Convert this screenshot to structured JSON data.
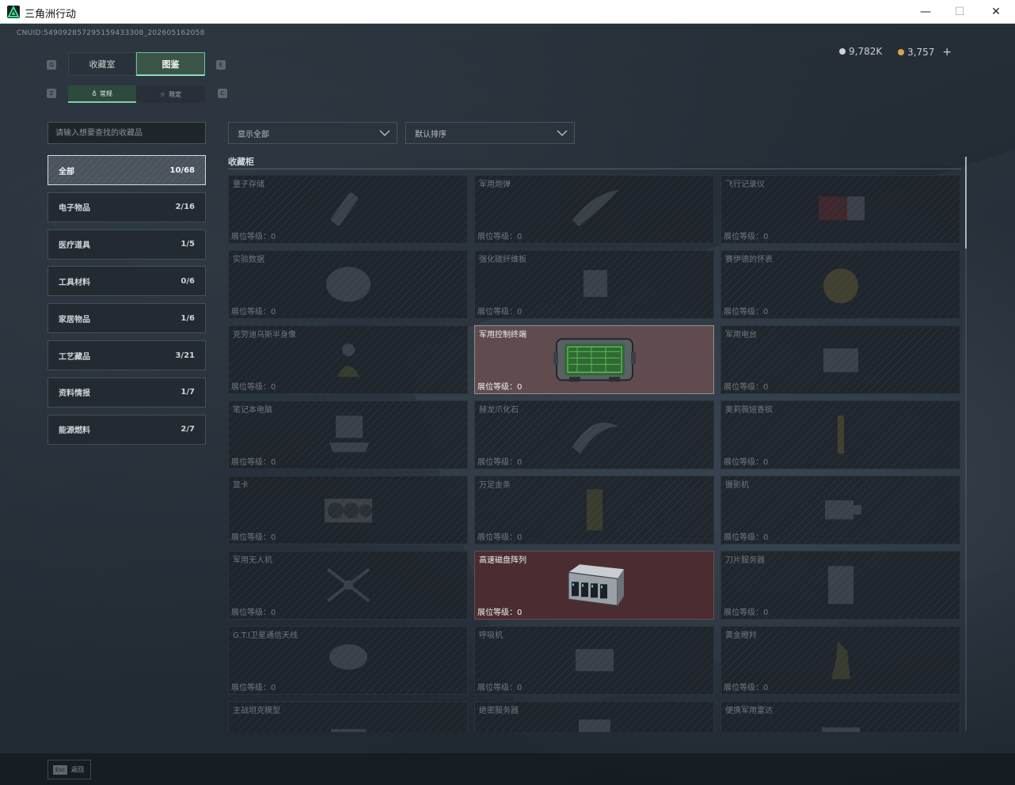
{
  "window": {
    "title": "三角洲行动",
    "minimize": "—",
    "maximize": "☐",
    "close": "✕"
  },
  "uid": "CNUID:549092857295159433308_202605162058",
  "currency": [
    {
      "value": "9,782K",
      "color": "#cfd4d8"
    },
    {
      "value": "3,757",
      "color": "#d7a64a",
      "add": "+"
    }
  ],
  "main_tabs": [
    {
      "label": "收藏室",
      "active": false
    },
    {
      "label": "图鉴",
      "active": true
    }
  ],
  "main_tab_keys": {
    "left": "Q",
    "right": "E"
  },
  "sub_tabs": [
    {
      "label": "常规",
      "icon": "leaf-icon",
      "active": true
    },
    {
      "label": "限定",
      "icon": "star-icon",
      "active": false
    }
  ],
  "sub_tab_keys": {
    "left": "Z",
    "right": "C"
  },
  "search": {
    "placeholder": "请输入想要查找的收藏品",
    "value": ""
  },
  "filters": [
    {
      "label": "显示全部"
    },
    {
      "label": "默认排序"
    }
  ],
  "categories": [
    {
      "label": "全部",
      "count": "10/68",
      "active": true
    },
    {
      "label": "电子物品",
      "count": "2/16"
    },
    {
      "label": "医疗道具",
      "count": "1/5"
    },
    {
      "label": "工具材料",
      "count": "0/6"
    },
    {
      "label": "家居物品",
      "count": "1/6"
    },
    {
      "label": "工艺藏品",
      "count": "3/21"
    },
    {
      "label": "资料情报",
      "count": "1/7"
    },
    {
      "label": "能源燃料",
      "count": "2/7"
    }
  ],
  "section": {
    "title": "收藏柜"
  },
  "level_label": "展位等级：0",
  "items": [
    {
      "name": "量子存储",
      "owned": false,
      "icon": "usb-drive-icon"
    },
    {
      "name": "军用炮弹",
      "owned": false,
      "icon": "artillery-shell-icon"
    },
    {
      "name": "飞行记录仪",
      "owned": false,
      "icon": "flight-recorder-icon"
    },
    {
      "name": "实验数据",
      "owned": false,
      "icon": "data-disc-icon"
    },
    {
      "name": "强化碳纤维板",
      "owned": false,
      "icon": "carbon-plate-icon"
    },
    {
      "name": "赛伊德的怀表",
      "owned": false,
      "icon": "pocket-watch-icon"
    },
    {
      "name": "克劳迪乌斯半身像",
      "owned": false,
      "icon": "bust-statue-icon"
    },
    {
      "name": "军用控制终端",
      "owned": true,
      "style": "a",
      "icon": "control-terminal-icon"
    },
    {
      "name": "军用电台",
      "owned": false,
      "icon": "radio-icon"
    },
    {
      "name": "笔记本电脑",
      "owned": false,
      "icon": "laptop-icon"
    },
    {
      "name": "赫龙爪化石",
      "owned": false,
      "icon": "claw-fossil-icon"
    },
    {
      "name": "奥莉薇娅香槟",
      "owned": false,
      "icon": "champagne-icon"
    },
    {
      "name": "显卡",
      "owned": false,
      "icon": "graphics-card-icon"
    },
    {
      "name": "万足金条",
      "owned": false,
      "icon": "gold-bar-icon"
    },
    {
      "name": "摄影机",
      "owned": false,
      "icon": "camera-icon"
    },
    {
      "name": "军用无人机",
      "owned": false,
      "icon": "drone-icon"
    },
    {
      "name": "高速磁盘阵列",
      "owned": true,
      "style": "b",
      "icon": "disk-array-icon"
    },
    {
      "name": "刀片服务器",
      "owned": false,
      "icon": "blade-server-icon"
    },
    {
      "name": "G.T.I卫星通信天线",
      "owned": false,
      "icon": "satellite-dish-icon"
    },
    {
      "name": "呼吸机",
      "owned": false,
      "icon": "ventilator-icon"
    },
    {
      "name": "黄金瞪羚",
      "owned": false,
      "icon": "gazelle-statue-icon"
    },
    {
      "name": "主战坦克模型",
      "owned": false,
      "icon": "tank-model-icon"
    },
    {
      "name": "绝密服务器",
      "owned": false,
      "icon": "server-icon"
    },
    {
      "name": "便携军用雷达",
      "owned": false,
      "icon": "radar-icon"
    }
  ],
  "footer": {
    "key": "Esc",
    "label": "返回"
  }
}
